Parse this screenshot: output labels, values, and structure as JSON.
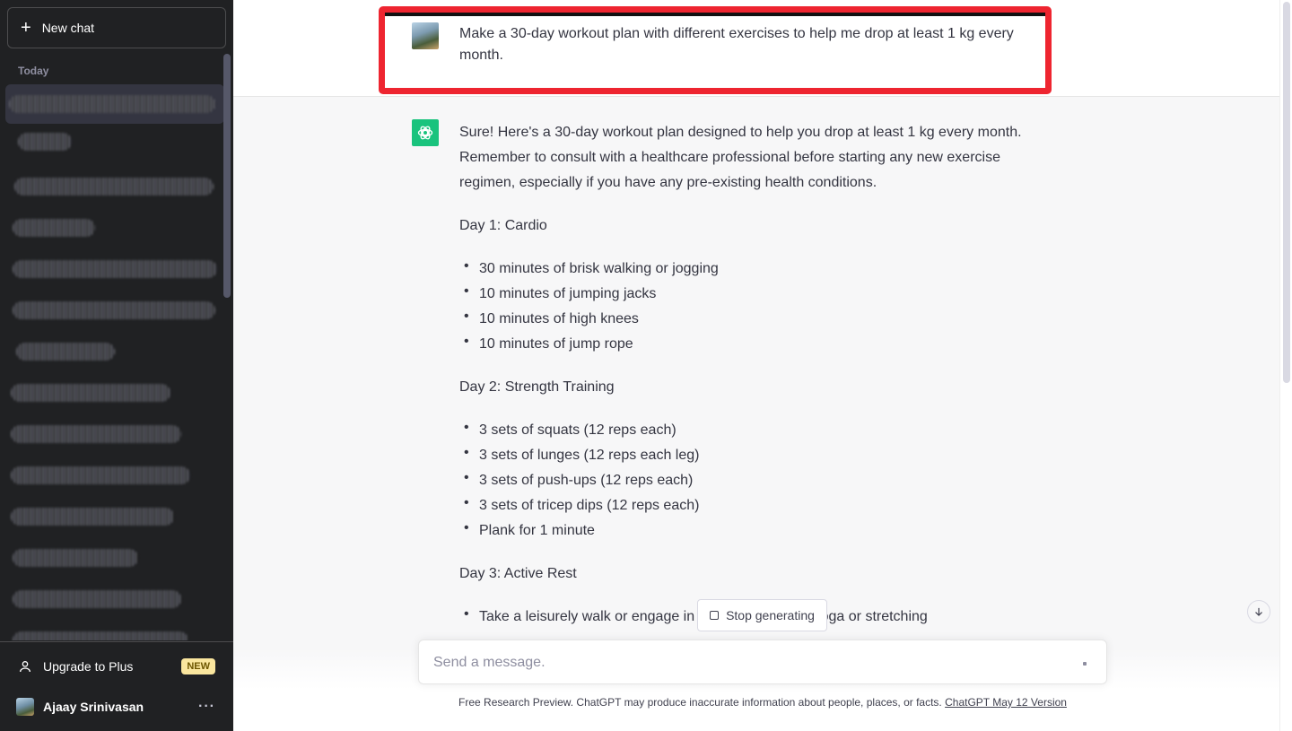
{
  "sidebar": {
    "new_chat_label": "New chat",
    "section_label": "Today",
    "upgrade_label": "Upgrade to Plus",
    "upgrade_badge": "NEW",
    "user_name": "Ajaay Srinivasan",
    "more_glyph": "···"
  },
  "conversation": {
    "user_message": "Make a 30-day workout plan with different exercises to help me drop at least 1 kg every month.",
    "assistant_intro": "Sure! Here's a 30-day workout plan designed to help you drop at least 1 kg every month. Remember to consult with a healthcare professional before starting any new exercise regimen, especially if you have any pre-existing health conditions.",
    "days": [
      {
        "heading": "Day 1: Cardio",
        "items": [
          "30 minutes of brisk walking or jogging",
          "10 minutes of jumping jacks",
          "10 minutes of high knees",
          "10 minutes of jump rope"
        ]
      },
      {
        "heading": "Day 2: Strength Training",
        "items": [
          "3 sets of squats (12 reps each)",
          "3 sets of lunges (12 reps each leg)",
          "3 sets of push-ups (12 reps each)",
          "3 sets of tricep dips (12 reps each)",
          "Plank for 1 minute"
        ]
      },
      {
        "heading": "Day 3: Active Rest",
        "items": [
          "Take a leisurely walk or engage in light activities like yoga or stretching"
        ]
      }
    ]
  },
  "composer": {
    "stop_label": "Stop generating",
    "placeholder": "Send a message."
  },
  "footer": {
    "note": "Free Research Preview. ChatGPT may produce inaccurate information about people, places, or facts.",
    "link_label": "ChatGPT May 12 Version"
  },
  "colors": {
    "sidebar_bg": "#202123",
    "assistant_accent": "#19c37d",
    "highlight_border": "#ee2530",
    "badge_bg": "#fae69e"
  },
  "icons": {
    "new_chat": "plus-icon",
    "upgrade": "user-icon",
    "assistant": "openai-logo-icon",
    "scroll_down": "arrow-down-icon",
    "stop": "stop-square-icon"
  }
}
